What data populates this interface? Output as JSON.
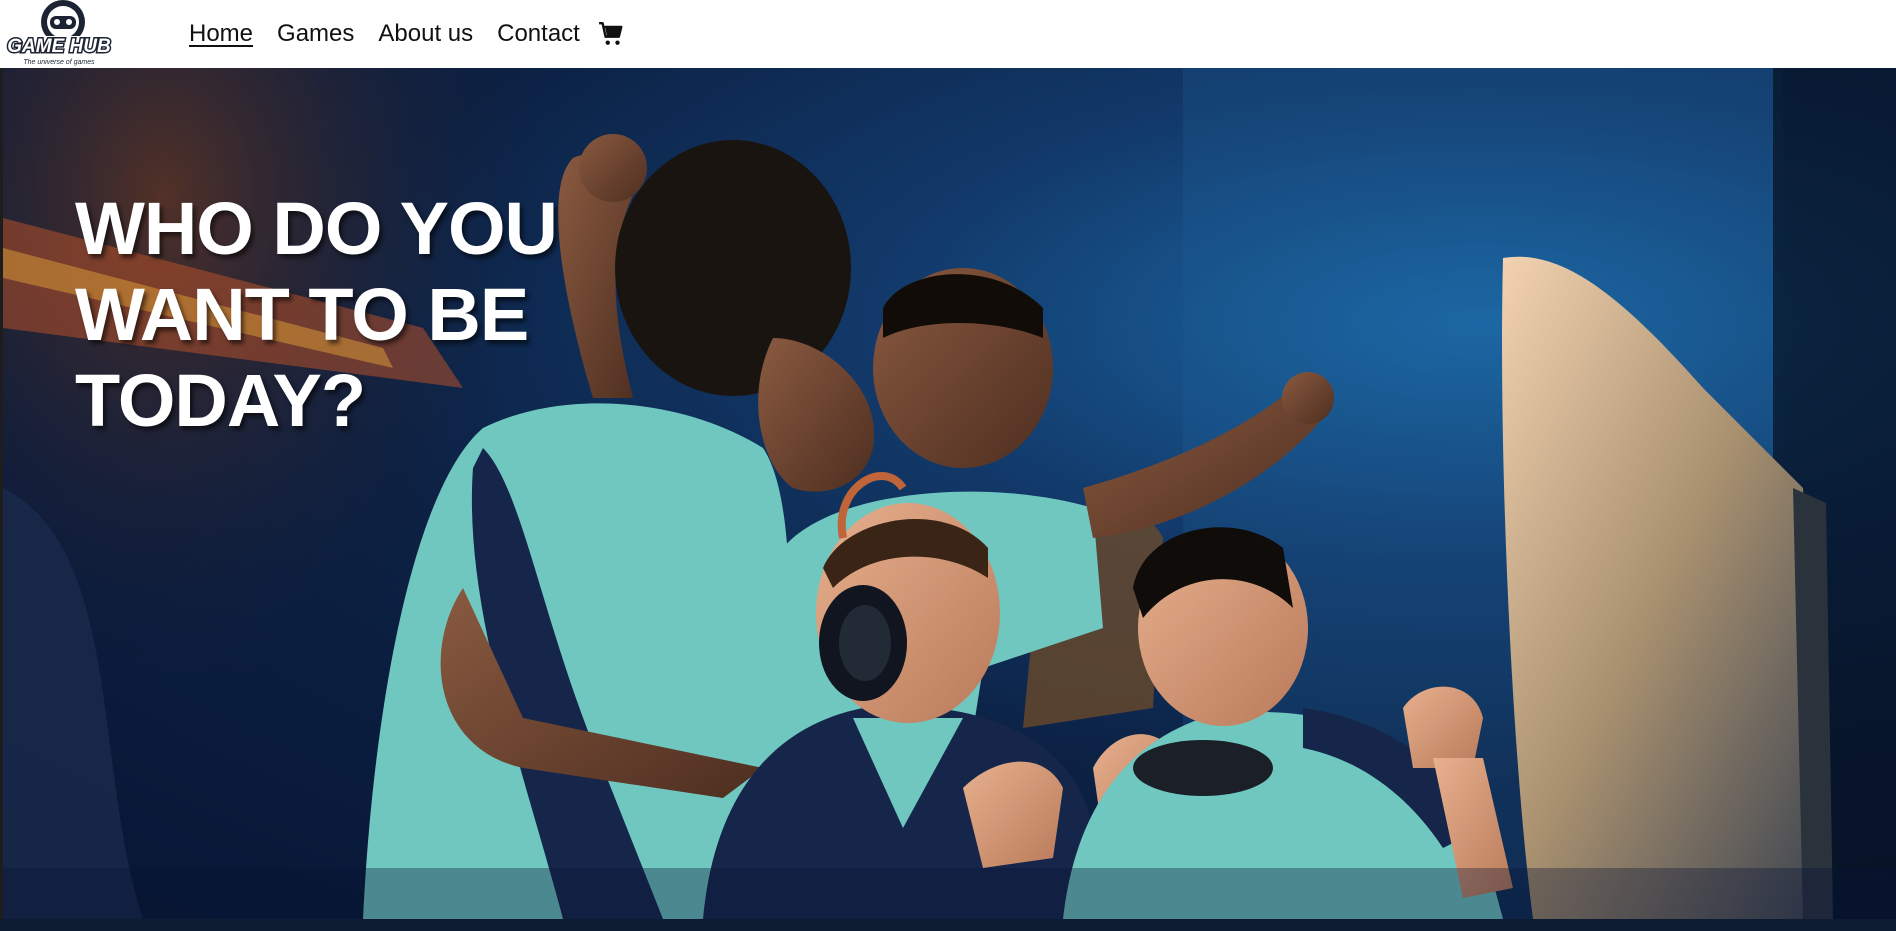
{
  "brand": {
    "name": "GAME HUB",
    "tagline": "The universe of games"
  },
  "nav": {
    "items": [
      {
        "label": "Home",
        "active": true
      },
      {
        "label": "Games",
        "active": false
      },
      {
        "label": "About us",
        "active": false
      },
      {
        "label": "Contact",
        "active": false
      }
    ],
    "cart_icon": "shopping-cart-icon"
  },
  "hero": {
    "title_lines": [
      "WHO DO YOU",
      "WANT TO BE",
      "TODAY?"
    ],
    "image_description_icon": "gamers-celebrating-photo"
  },
  "colors": {
    "nav_bg": "#ffffff",
    "hero_dark": "#081533",
    "hero_blue": "#1b6aa8",
    "jersey_teal": "#6fc7c0",
    "jersey_navy": "#15264a"
  }
}
